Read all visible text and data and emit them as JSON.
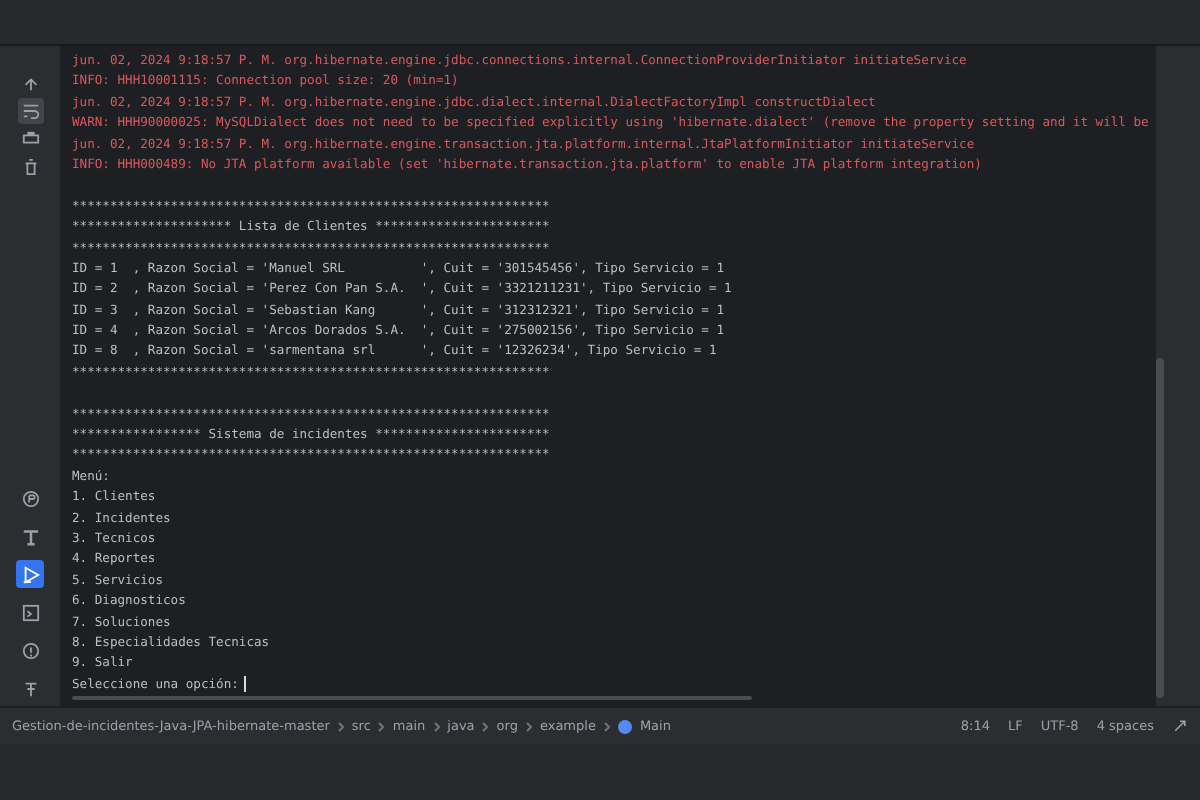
{
  "console_actions": [
    {
      "kind": "up",
      "selected": false
    },
    {
      "kind": "wrap",
      "selected": true
    },
    {
      "kind": "print",
      "selected": false
    },
    {
      "kind": "trash",
      "selected": false
    }
  ],
  "tool_buttons": [
    {
      "kind": "plugin",
      "selected": false
    },
    {
      "kind": "text",
      "selected": false
    },
    {
      "kind": "run",
      "selected": true
    },
    {
      "kind": "terminal",
      "selected": false
    },
    {
      "kind": "problems",
      "selected": false
    },
    {
      "kind": "git",
      "selected": false
    }
  ],
  "console": {
    "lines": [
      {
        "kind": "error",
        "text": "jun. 02, 2024 9:18:57 P. M. org.hibernate.engine.jdbc.connections.internal.ConnectionProviderInitiator initiateService"
      },
      {
        "kind": "error",
        "text": "INFO: HHH10001115: Connection pool size: 20 (min=1)"
      },
      {
        "kind": "error",
        "text": "jun. 02, 2024 9:18:57 P. M. org.hibernate.engine.jdbc.dialect.internal.DialectFactoryImpl constructDialect"
      },
      {
        "kind": "error",
        "text": "WARN: HHH90000025: MySQLDialect does not need to be specified explicitly using 'hibernate.dialect' (remove the property setting and it will be"
      },
      {
        "kind": "error",
        "text": "jun. 02, 2024 9:18:57 P. M. org.hibernate.engine.transaction.jta.platform.internal.JtaPlatformInitiator initiateService"
      },
      {
        "kind": "error",
        "text": "INFO: HHH000489: No JTA platform available (set 'hibernate.transaction.jta.platform' to enable JTA platform integration)"
      },
      {
        "kind": "blank"
      },
      {
        "kind": "output",
        "text": "***************************************************************"
      },
      {
        "kind": "output",
        "text": "********************* Lista de Clientes ***********************"
      },
      {
        "kind": "output",
        "text": "***************************************************************"
      },
      {
        "kind": "output",
        "text": "ID = 1  , Razon Social = 'Manuel SRL          ', Cuit = '301545456', Tipo Servicio = 1"
      },
      {
        "kind": "output",
        "text": "ID = 2  , Razon Social = 'Perez Con Pan S.A.  ', Cuit = '3321211231', Tipo Servicio = 1"
      },
      {
        "kind": "output",
        "text": "ID = 3  , Razon Social = 'Sebastian Kang      ', Cuit = '312312321', Tipo Servicio = 1"
      },
      {
        "kind": "output",
        "text": "ID = 4  , Razon Social = 'Arcos Dorados S.A.  ', Cuit = '275002156', Tipo Servicio = 1"
      },
      {
        "kind": "output",
        "text": "ID = 8  , Razon Social = 'sarmentana srl      ', Cuit = '12326234', Tipo Servicio = 1"
      },
      {
        "kind": "output",
        "text": "***************************************************************"
      },
      {
        "kind": "blank"
      },
      {
        "kind": "output",
        "text": "***************************************************************"
      },
      {
        "kind": "output",
        "text": "***************** Sistema de incidentes ***********************"
      },
      {
        "kind": "output",
        "text": "***************************************************************"
      },
      {
        "kind": "output",
        "text": "Menú:"
      },
      {
        "kind": "output",
        "text": "1. Clientes"
      },
      {
        "kind": "output",
        "text": "2. Incidentes"
      },
      {
        "kind": "output",
        "text": "3. Tecnicos"
      },
      {
        "kind": "output",
        "text": "4. Reportes"
      },
      {
        "kind": "output",
        "text": "5. Servicios"
      },
      {
        "kind": "output",
        "text": "6. Diagnosticos"
      },
      {
        "kind": "output",
        "text": "7. Soluciones"
      },
      {
        "kind": "output",
        "text": "8. Especialidades Tecnicas"
      },
      {
        "kind": "output",
        "text": "9. Salir"
      },
      {
        "kind": "prompt",
        "text": "Seleccione una opción:"
      }
    ]
  },
  "status_bar": {
    "breadcrumbs": [
      "Gestion-de-incidentes-Java-JPA-hibernate-master",
      "src",
      "main",
      "java",
      "org",
      "example",
      "Main"
    ],
    "position": "8:14",
    "line_separator": "LF",
    "encoding": "UTF-8",
    "indent": "4 spaces"
  }
}
